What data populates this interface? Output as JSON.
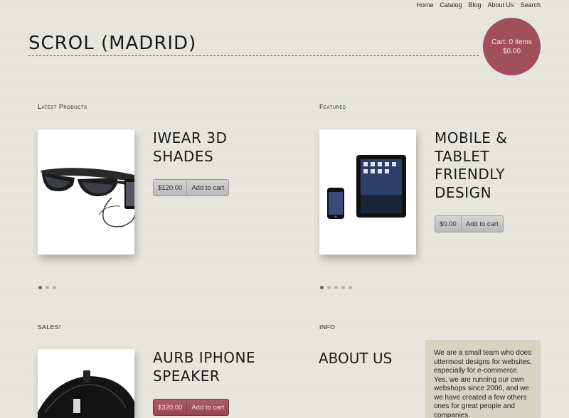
{
  "nav": {
    "items": [
      "Home",
      "Catalog",
      "Blog",
      "About Us",
      "Search"
    ]
  },
  "site": {
    "title": "SCROL (MADRID)"
  },
  "cart": {
    "line1": "Cart: 0 items",
    "line2": "$0.00"
  },
  "sections": {
    "latest": "Latest Products",
    "featured": "Featured",
    "sales": "SALES!",
    "info": "INFO"
  },
  "products": {
    "latest": {
      "title_line1": "IWEAR 3D",
      "title_line2": "SHADES",
      "price": "$120.00",
      "cta": "Add to cart"
    },
    "featured": {
      "title_line1": "MOBILE &",
      "title_line2": "TABLET",
      "title_line3": "FRIENDLY",
      "title_line4": "DESIGN",
      "price": "$0.00",
      "cta": "Add to cart"
    },
    "sales": {
      "title_line1": "AURB IPHONE",
      "title_line2": "SPEAKER",
      "price": "$320.00",
      "cta": "Add to cart"
    }
  },
  "carousel": {
    "latest_count": 3,
    "featured_count": 5
  },
  "about": {
    "title": "ABOUT US",
    "text": "We are a small team who does uttermost designs for websites, especially for e-commerce. Yes, we are running our own webshops since 2006, and we we have created a few others ones for great people and companies."
  },
  "colors": {
    "accent": "#a04f5b",
    "background": "#e7e5de",
    "info_box": "#d5d4c3"
  },
  "icons": {
    "latest_image": "3d-glasses-image",
    "featured_image": "tablet-phone-image",
    "sales_image": "speaker-image"
  }
}
